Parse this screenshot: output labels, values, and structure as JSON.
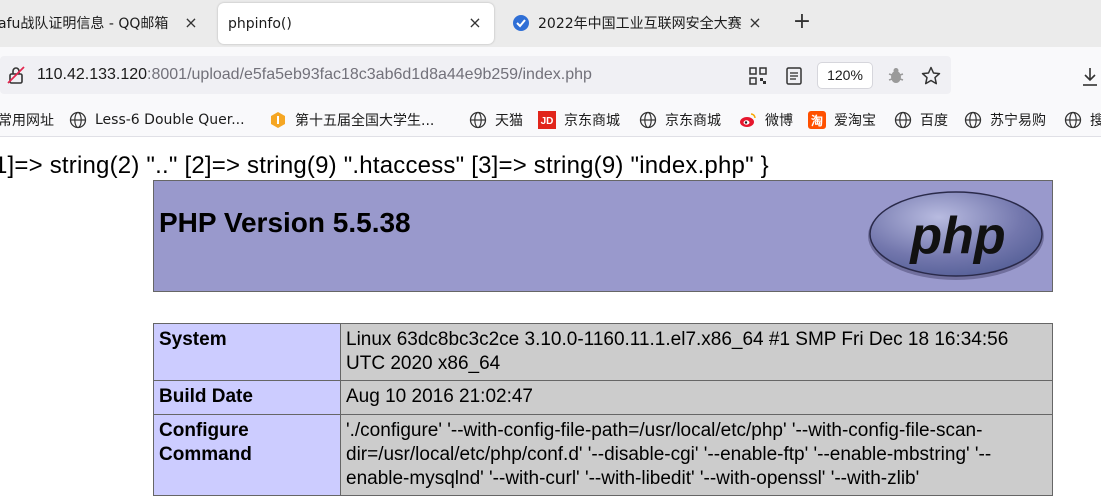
{
  "tabs": [
    {
      "title": "afu战队证明信息 - QQ邮箱",
      "close": "×"
    },
    {
      "title": "phpinfo()",
      "close": "×"
    },
    {
      "title": "2022年中国工业互联网安全大赛",
      "close": "×"
    }
  ],
  "new_tab": "+",
  "address": {
    "host": "110.42.133.120",
    "rest": ":8001/upload/e5fa5eb93fac18c3ab6d1d8a44e9b259/index.php",
    "zoom": "120%"
  },
  "bookmarks": [
    {
      "label": "常用网址",
      "icon": "folder-icon"
    },
    {
      "label": "Less-6 Double Quer...",
      "icon": "globe-icon"
    },
    {
      "label": "第十五届全国大学生...",
      "icon": "site-logo-icon"
    },
    {
      "label": "天猫",
      "icon": "globe-icon"
    },
    {
      "label": "京东商城",
      "icon": "jd-icon"
    },
    {
      "label": "京东商城",
      "icon": "globe-icon"
    },
    {
      "label": "微博",
      "icon": "weibo-icon"
    },
    {
      "label": "爱淘宝",
      "icon": "taobao-icon"
    },
    {
      "label": "百度",
      "icon": "globe-icon"
    },
    {
      "label": "苏宁易购",
      "icon": "globe-icon"
    },
    {
      "label": "搜",
      "icon": "globe-icon"
    }
  ],
  "page": {
    "dump_line": "1]=> string(2) \"..\" [2]=> string(9) \".htaccess\" [3]=> string(9) \"index.php\" }",
    "php_version": "PHP Version 5.5.38",
    "logo_text": "php",
    "rows": [
      {
        "key": "System",
        "value": "Linux 63dc8bc3c2ce 3.10.0-1160.11.1.el7.x86_64 #1 SMP Fri Dec 18 16:34:56 UTC 2020 x86_64"
      },
      {
        "key": "Build Date",
        "value": "Aug 10 2016 21:02:47"
      },
      {
        "key": "Configure Command",
        "value": "'./configure' '--with-config-file-path=/usr/local/etc/php' '--with-config-file-scan-dir=/usr/local/etc/php/conf.d' '--disable-cgi' '--enable-ftp' '--enable-mbstring' '--enable-mysqlnd' '--with-curl' '--with-libedit' '--with-openssl' '--with-zlib'"
      }
    ]
  }
}
